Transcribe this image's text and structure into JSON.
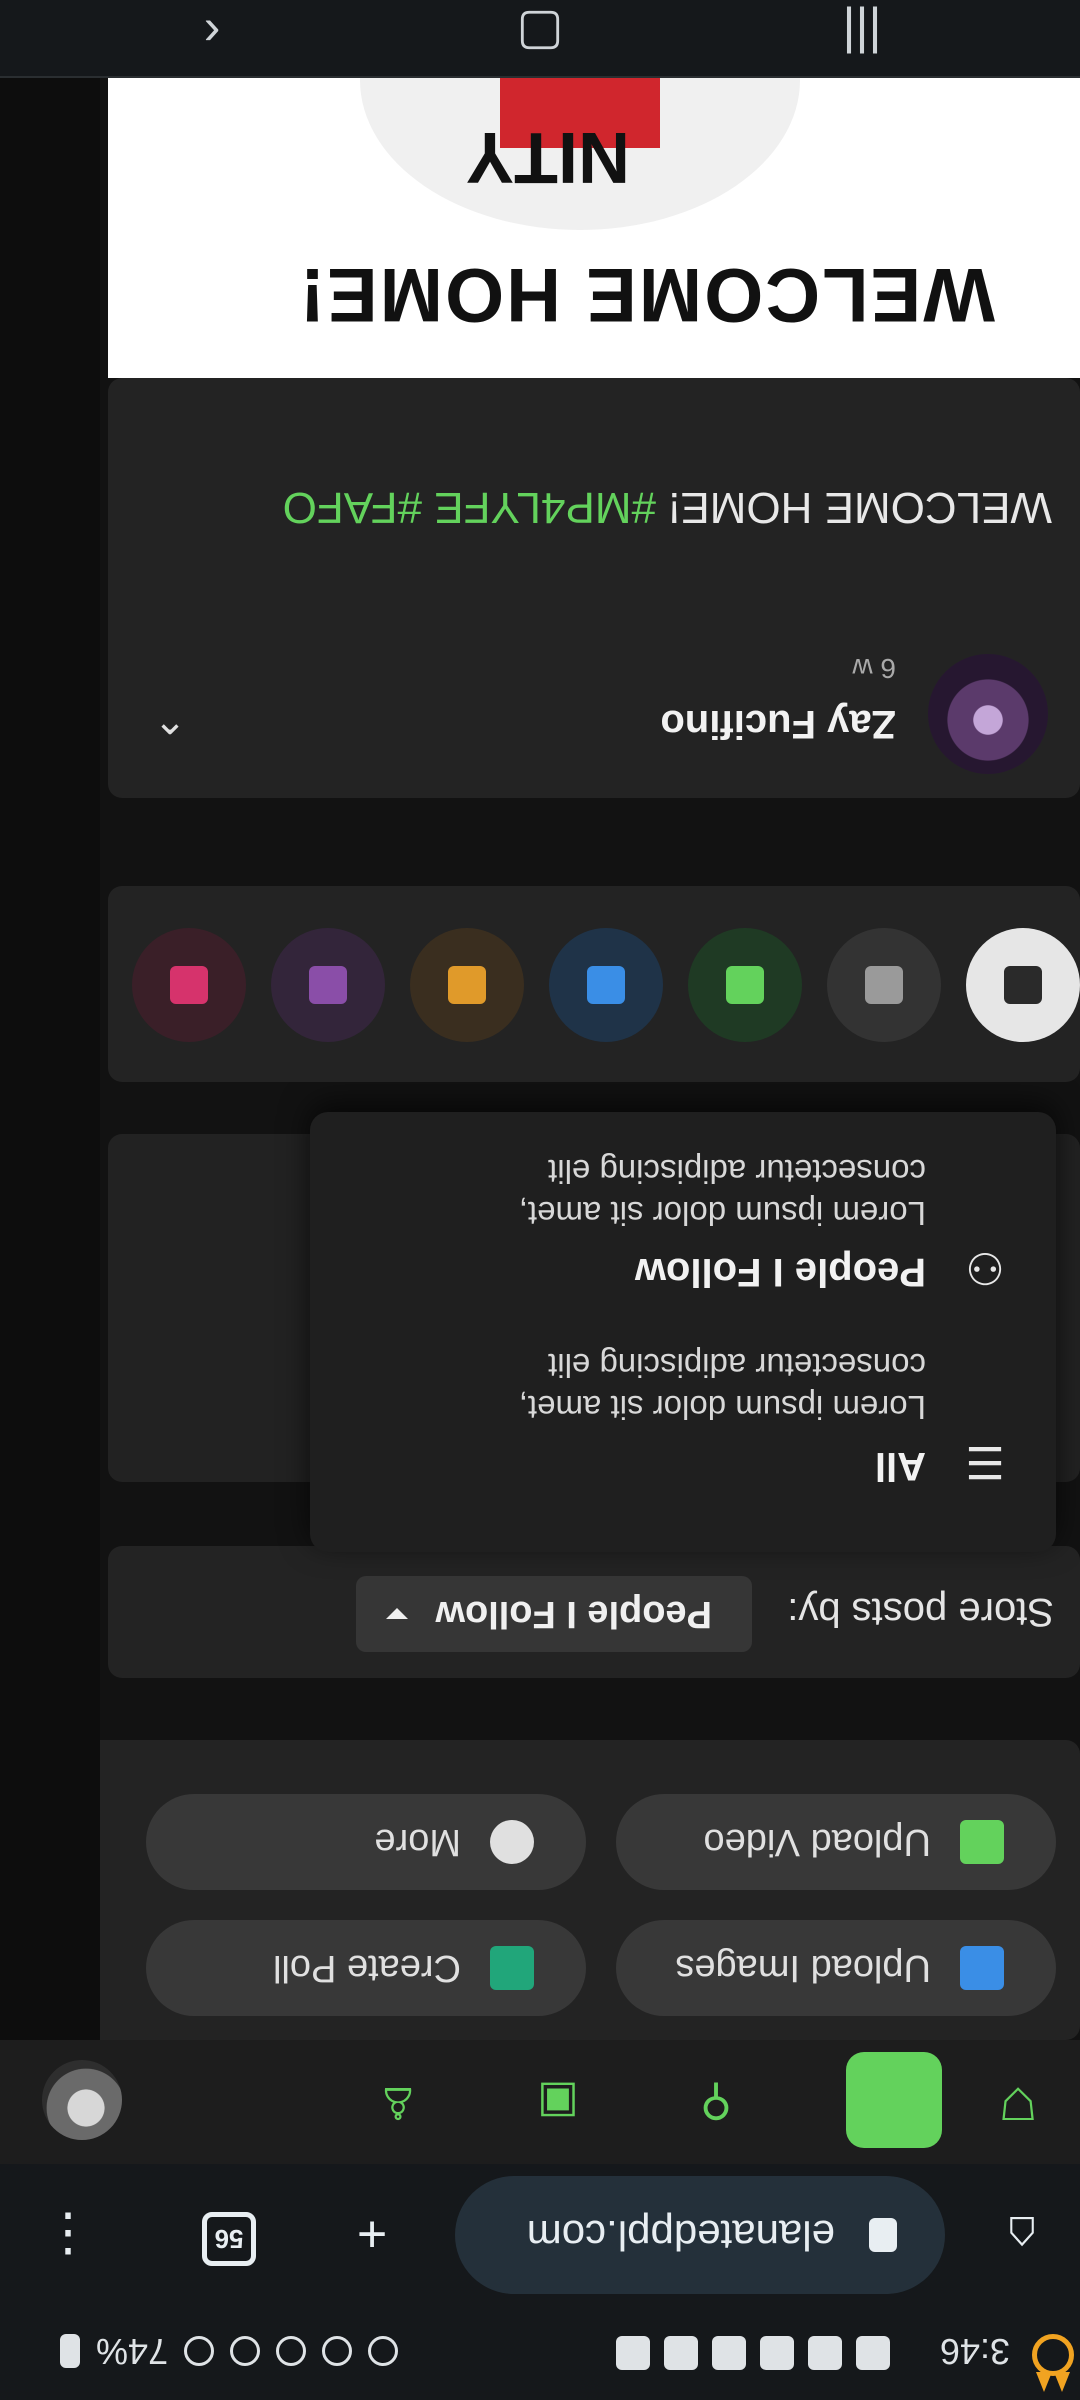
{
  "status_bar": {
    "time": "3:46",
    "battery": "74%",
    "notification_icons": [
      "calendar-icon",
      "message-icon",
      "message-icon",
      "message-icon",
      "gmail-icon",
      "app-icon",
      "dot-icon"
    ],
    "system_icons": [
      "signal-icon",
      "wifi-icon",
      "bluetooth-icon",
      "alarm-icon",
      "lock-icon",
      "battery-icon"
    ]
  },
  "browser": {
    "url": "elanatedppl.com",
    "tab_count": "56"
  },
  "app_nav": {
    "items": [
      "shield-icon",
      "home-icon",
      "add-user-icon",
      "robot-icon",
      "bucket-icon",
      "avatar"
    ]
  },
  "composer": {
    "buttons": [
      {
        "label": "Upload Images",
        "icon": "image-icon",
        "color": "#3a8ee6"
      },
      {
        "label": "Create Poll",
        "icon": "poll-icon",
        "color": "#21a67a"
      },
      {
        "label": "Upload Video",
        "icon": "video-icon",
        "color": "#63d25c"
      },
      {
        "label": "More",
        "icon": "plus-circle-icon",
        "color": "#e0e0e0"
      }
    ]
  },
  "store_posts": {
    "label": "Store posts by:",
    "selected": "People I Follow"
  },
  "dropdown": {
    "options": [
      {
        "title": "All",
        "description": "Lorem ipsum dolor sit amet, consectetur adipiscing elit",
        "icon": "filter-icon"
      },
      {
        "title": "People I Follow",
        "description": "Lorem ipsum dolor sit amet, consectetur adipiscing elit",
        "icon": "people-icon"
      }
    ]
  },
  "post_types": [
    {
      "icon": "article-icon",
      "bg": "#e6e6e6",
      "fg": "#2a2a2a"
    },
    {
      "icon": "text-icon",
      "bg": "#333333",
      "fg": "#9a9a9a"
    },
    {
      "icon": "image-icon",
      "bg": "#1f3a24",
      "fg": "#63d25c"
    },
    {
      "icon": "video-icon",
      "bg": "#1f3348",
      "fg": "#3a8ee6"
    },
    {
      "icon": "music-icon",
      "bg": "#3a2e1f",
      "fg": "#e09a2a"
    },
    {
      "icon": "document-icon",
      "bg": "#33253a",
      "fg": "#8a4ea8"
    },
    {
      "icon": "book-icon",
      "bg": "#3a1f28",
      "fg": "#d6336c"
    }
  ],
  "post": {
    "author": "Zay Fucifino",
    "time": "6 w",
    "text_plain": "WELCOME HOME! ",
    "tags": "#MP4LYFE #FAFO",
    "image_headline": "WELCOME HOME!",
    "image_logo_text": "NITY"
  },
  "system_nav": {
    "buttons": [
      "recents-icon",
      "home-icon",
      "back-icon"
    ]
  },
  "colors": {
    "accent": "#63d25c",
    "background": "#121212",
    "card": "#232323"
  }
}
